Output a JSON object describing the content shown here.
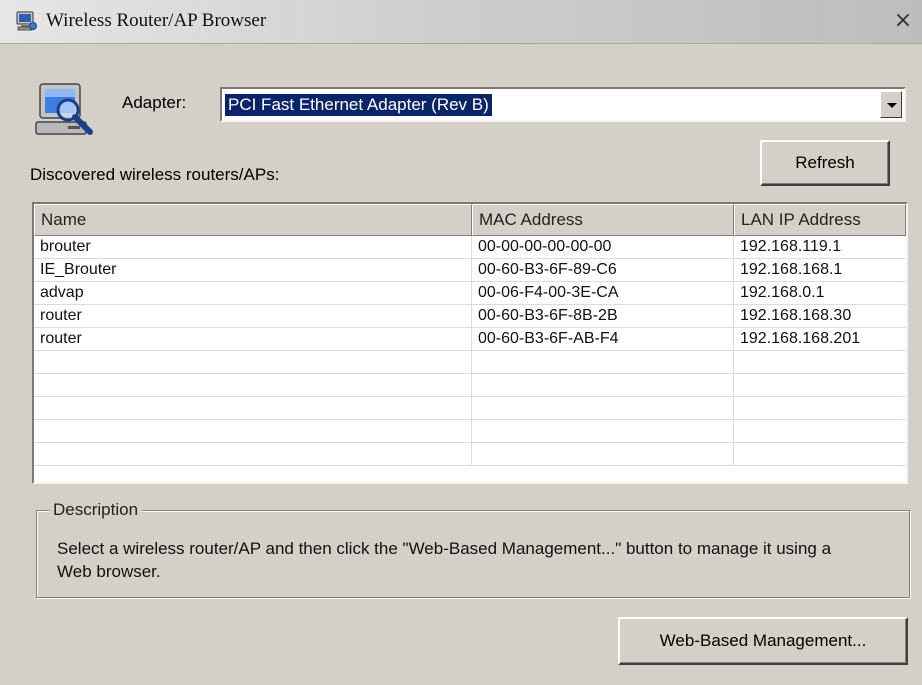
{
  "window": {
    "title": "Wireless Router/AP Browser",
    "close_glyph": "×"
  },
  "adapter": {
    "label": "Adapter:",
    "selected": "PCI Fast Ethernet Adapter (Rev B)"
  },
  "discovered_label": "Discovered wireless routers/APs:",
  "refresh_button": "Refresh",
  "table": {
    "columns": [
      "Name",
      "MAC Address",
      "LAN IP Address"
    ],
    "rows": [
      [
        "brouter",
        "00-00-00-00-00-00",
        "192.168.119.1"
      ],
      [
        "IE_Brouter",
        "00-60-B3-6F-89-C6",
        "192.168.168.1"
      ],
      [
        "advap",
        "00-06-F4-00-3E-CA",
        "192.168.0.1"
      ],
      [
        "router",
        "00-60-B3-6F-8B-2B",
        "192.168.168.30"
      ],
      [
        "router",
        "00-60-B3-6F-AB-F4",
        "192.168.168.201"
      ],
      [
        "",
        "",
        ""
      ],
      [
        "",
        "",
        ""
      ],
      [
        "",
        "",
        ""
      ],
      [
        "",
        "",
        ""
      ],
      [
        "",
        "",
        ""
      ]
    ]
  },
  "description": {
    "legend": "Description",
    "text": "Select a wireless router/AP and then click the \"Web-Based Management...\" button to manage it using a Web browser."
  },
  "web_button": "Web-Based Management...",
  "icons": {
    "title": "network-computer-icon",
    "adapter": "computer-search-icon"
  }
}
